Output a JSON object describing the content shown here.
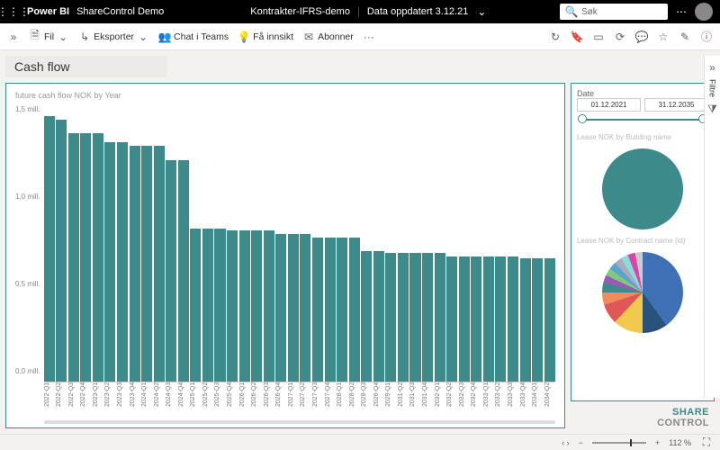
{
  "header": {
    "product": "Power BI",
    "workspace": "ShareControl Demo",
    "report": "Kontrakter-IFRS-demo",
    "updated_label": "Data oppdatert 3.12.21",
    "search_placeholder": "Søk"
  },
  "cmdbar": {
    "fil": "Fil",
    "eksporter": "Eksporter",
    "chat": "Chat i Teams",
    "innsikt": "Få innsikt",
    "abonner": "Abonner",
    "more": "···"
  },
  "report": {
    "title": "Cash flow"
  },
  "side": {
    "date_label": "Date",
    "date_from": "01.12.2021",
    "date_to": "31.12.2035",
    "pie1_title": "Lease NOK by Building name",
    "pie2_title": "Lease NOK by Contract name (id)"
  },
  "logo": {
    "share": "SHARE",
    "control": "CONTROL"
  },
  "status": {
    "pager": "‹  ›",
    "zoom": "112 %",
    "minus": "−",
    "plus": "+"
  },
  "filters": {
    "label": "Filtre",
    "icon": "»"
  },
  "chart_data": {
    "type": "bar",
    "title": "future cash flow NOK by Year",
    "ylabel": "",
    "ylim": [
      0,
      1.5
    ],
    "y_ticks": [
      "1,5 mill.",
      "1,0 mill.",
      "0,5 mill.",
      "0,0 mill."
    ],
    "unit": "mill.",
    "categories": [
      "2022-Q1",
      "2022-Q2",
      "2022-Q3",
      "2022-Q4",
      "2023-Q1",
      "2023-Q2",
      "2023-Q3",
      "2023-Q4",
      "2024-Q1",
      "2024-Q2",
      "2024-Q3",
      "2024-Q4",
      "2025-Q1",
      "2025-Q2",
      "2025-Q3",
      "2025-Q4",
      "2026-Q1",
      "2026-Q2",
      "2026-Q3",
      "2026-Q4",
      "2027-Q1",
      "2027-Q2",
      "2027-Q3",
      "2027-Q4",
      "2028-Q1",
      "2028-Q2",
      "2028-Q3",
      "2028-Q4",
      "2029-Q1",
      "2031-Q2",
      "2031-Q3",
      "2031-Q4",
      "2032-Q1",
      "2032-Q2",
      "2032-Q3",
      "2032-Q4",
      "2033-Q1",
      "2033-Q2",
      "2033-Q3",
      "2033-Q4",
      "2034-Q1",
      "2034-Q2"
    ],
    "values": [
      1.44,
      1.42,
      1.35,
      1.35,
      1.35,
      1.3,
      1.3,
      1.28,
      1.28,
      1.28,
      1.2,
      1.2,
      0.83,
      0.83,
      0.83,
      0.82,
      0.82,
      0.82,
      0.82,
      0.8,
      0.8,
      0.8,
      0.78,
      0.78,
      0.78,
      0.78,
      0.71,
      0.71,
      0.7,
      0.7,
      0.7,
      0.7,
      0.7,
      0.68,
      0.68,
      0.68,
      0.68,
      0.68,
      0.68,
      0.67,
      0.67,
      0.67
    ]
  }
}
